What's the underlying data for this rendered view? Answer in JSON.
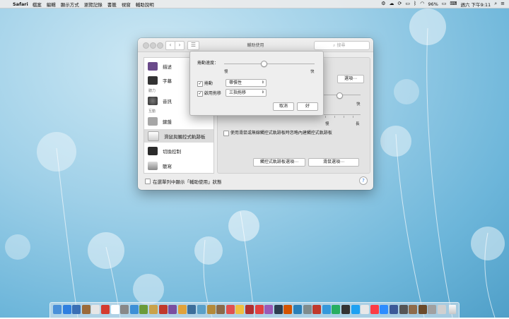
{
  "menubar": {
    "app_name": "Safari",
    "items": [
      "檔案",
      "編輯",
      "顯示方式",
      "瀏覽記錄",
      "書籤",
      "視窗",
      "輔助說明"
    ],
    "battery": "96%",
    "clock": "週六 下午9:11"
  },
  "window": {
    "title": "輔助使用",
    "search_placeholder": "搜尋",
    "sidebar": {
      "items": [
        {
          "label": "描述",
          "icon": "description-icon",
          "color": "#6a4a8a"
        },
        {
          "label": "字幕",
          "icon": "captions-icon",
          "color": "#333333"
        },
        {
          "label": "音訊",
          "icon": "speaker-icon",
          "color": "#555555"
        },
        {
          "label": "鍵盤",
          "icon": "keyboard-icon",
          "color": "#9a9a9a"
        },
        {
          "label": "滑鼠與觸控式軌跡板",
          "icon": "mouse-icon",
          "color": "#e8e8e8"
        },
        {
          "label": "切換控制",
          "icon": "switch-control-icon",
          "color": "#2b2b2b"
        },
        {
          "label": "聽寫",
          "icon": "microphone-icon",
          "color": "#8a8a8a"
        }
      ],
      "sections": [
        "聽力",
        "互動"
      ],
      "selected": "滑鼠與觸控式軌跡板"
    },
    "pane": {
      "options_button": "選項⋯",
      "fast_label": "快",
      "slow_label": "慢",
      "long_label": "長",
      "ignore_checkbox_label": "使用滑鼠或無線觸控式軌跡板時忽略內建觸控式軌跡板",
      "trackpad_options_button": "觸控式軌跡板選項⋯",
      "mouse_options_button": "滑鼠選項⋯"
    },
    "show_in_menubar_label": "在選單列中顯示「輔助使用」狀態",
    "help_label": "?"
  },
  "sheet": {
    "scroll_speed_label": "捲動速度：",
    "slow_label": "慢",
    "fast_label": "快",
    "scroll_label": "捲動",
    "scroll_value": "帶慣性",
    "drag_label": "啟用拖移",
    "drag_value": "三指拖移",
    "cancel_button": "取消",
    "ok_button": "好"
  },
  "dock": {
    "icon_count": 41
  }
}
